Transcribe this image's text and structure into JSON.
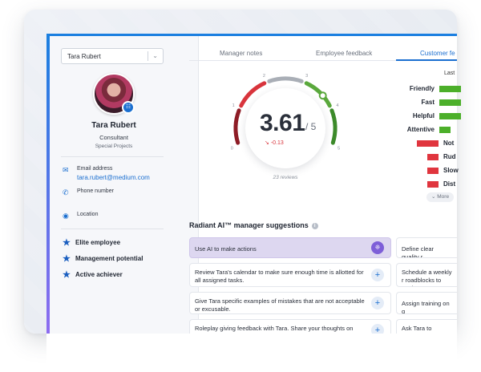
{
  "employee_select": {
    "value": "Tara Rubert"
  },
  "profile": {
    "name": "Tara Rubert",
    "role": "Consultant",
    "department": "Special Projects"
  },
  "contact": {
    "email_label": "Email address",
    "email_value": "tara.rubert@medium.com",
    "phone_label": "Phone number",
    "location_label": "Location"
  },
  "badges": [
    {
      "label": "Elite employee",
      "icon": "star-icon"
    },
    {
      "label": "Management potential",
      "icon": "star-icon"
    },
    {
      "label": "Active achiever",
      "icon": "star-icon"
    }
  ],
  "tabs": [
    {
      "label": "Manager notes"
    },
    {
      "label": "Employee feedback"
    },
    {
      "label": "Customer fe",
      "active": true
    }
  ],
  "gauge": {
    "score": "3.61",
    "out_of": "/ 5",
    "delta": "-0.13",
    "reviews": "23 reviews",
    "scale_labels": [
      "0",
      "1",
      "2",
      "3",
      "4",
      "5"
    ],
    "segment_colors": [
      "#8e1c26",
      "#d8343c",
      "#a9aeb6",
      "#5aa83c",
      "#3c8a2a"
    ],
    "value": 3.61,
    "max": 5
  },
  "ratings": {
    "title": "Last",
    "positive": [
      {
        "label": "Friendly",
        "value": 0.9
      },
      {
        "label": "Fast",
        "value": 0.9
      },
      {
        "label": "Helpful",
        "value": 0.9
      },
      {
        "label": "Attentive",
        "value": 0.45
      }
    ],
    "negative": [
      {
        "label": "Not",
        "value": 0.9
      },
      {
        "label": "Rud",
        "value": 0.45
      },
      {
        "label": "Slow",
        "value": 0.45
      },
      {
        "label": "Dist",
        "value": 0.45
      }
    ],
    "positive_color": "#4caf2a",
    "negative_color": "#e0353e",
    "more_label": "More"
  },
  "suggestions": {
    "title": "Radiant AI™ manager suggestions",
    "left": [
      {
        "text": "Use AI to make actions",
        "primary": true,
        "icon": "lightbulb-icon"
      },
      {
        "text": "Review Tara's calendar to make sure enough time is allotted for all assigned tasks.",
        "icon": "plus-icon"
      },
      {
        "text": "Give Tara specific examples of mistakes that are not acceptable or excusable.",
        "icon": "plus-icon"
      },
      {
        "text": "Roleplay giving feedback with Tara. Share your thoughts on",
        "icon": "plus-icon"
      }
    ],
    "right": [
      {
        "text": "Define clear quality r"
      },
      {
        "text": "Schedule a weekly r roadblocks to gettin"
      },
      {
        "text": "Assign training on q"
      },
      {
        "text": "Ask Tara to investig personal producti"
      }
    ]
  }
}
